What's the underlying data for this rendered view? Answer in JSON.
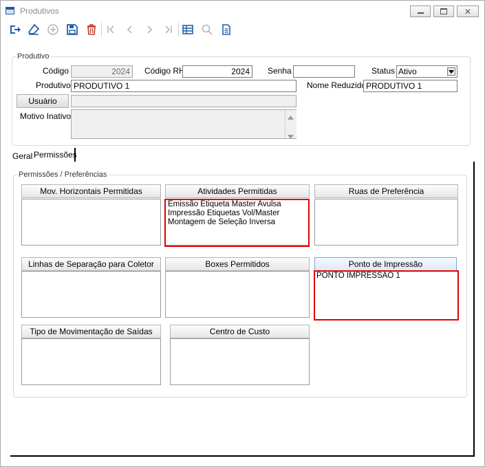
{
  "window": {
    "title": "Produtivos",
    "min_icon": "minimize-icon",
    "max_icon": "maximize-icon",
    "close_icon": "close-icon"
  },
  "toolbar": {
    "icons": [
      "exit-icon",
      "eraser-icon",
      "add-icon",
      "save-icon",
      "delete-icon",
      "first-icon",
      "prev-icon",
      "next-icon",
      "last-icon",
      "table-icon",
      "search-icon",
      "report-icon"
    ]
  },
  "produtivo": {
    "group_title": "Produtivo",
    "codigo_label": "Código",
    "codigo_value": "2024",
    "codigo_rh_label": "Código RH",
    "codigo_rh_value": "2024",
    "senha_label": "Senha",
    "senha_value": "",
    "status_label": "Status",
    "status_value": "Ativo",
    "produtivo_label": "Produtivo",
    "produtivo_value": "PRODUTIVO 1",
    "nome_reduzido_label": "Nome Reduzido",
    "nome_reduzido_value": "PRODUTIVO 1",
    "usuario_button": "Usuário",
    "usuario_value": "",
    "motivo_label": "Motivo Inativo",
    "motivo_value": ""
  },
  "tabs": [
    {
      "label": "Geral"
    },
    {
      "label": "Permissões"
    }
  ],
  "permissoes": {
    "group_title": "Permissões / Preferências",
    "lists": [
      {
        "title": "Mov. Horizontais Permitidas",
        "items": []
      },
      {
        "title": "Atividades Permitidas",
        "items": [
          "Emissão Etiqueta Master Avulsa",
          "Impressão Etiquetas Vol/Master",
          "Montagem de Seleção Inversa"
        ]
      },
      {
        "title": "Ruas de Preferência",
        "items": []
      },
      {
        "title": "Linhas de Separação para Coletor",
        "items": []
      },
      {
        "title": "Boxes Permitidos",
        "items": []
      },
      {
        "title": "Ponto de Impressão",
        "items": [
          "PONTO IMPRESSAO 1"
        ]
      },
      {
        "title": "Tipo de Movimentação de Saídas",
        "items": []
      },
      {
        "title": "Centro de Custo",
        "items": []
      }
    ]
  },
  "colors": {
    "highlight": "#e00000",
    "toolbar_blue": "#1f5fa8",
    "delete_red": "#c0392b"
  }
}
